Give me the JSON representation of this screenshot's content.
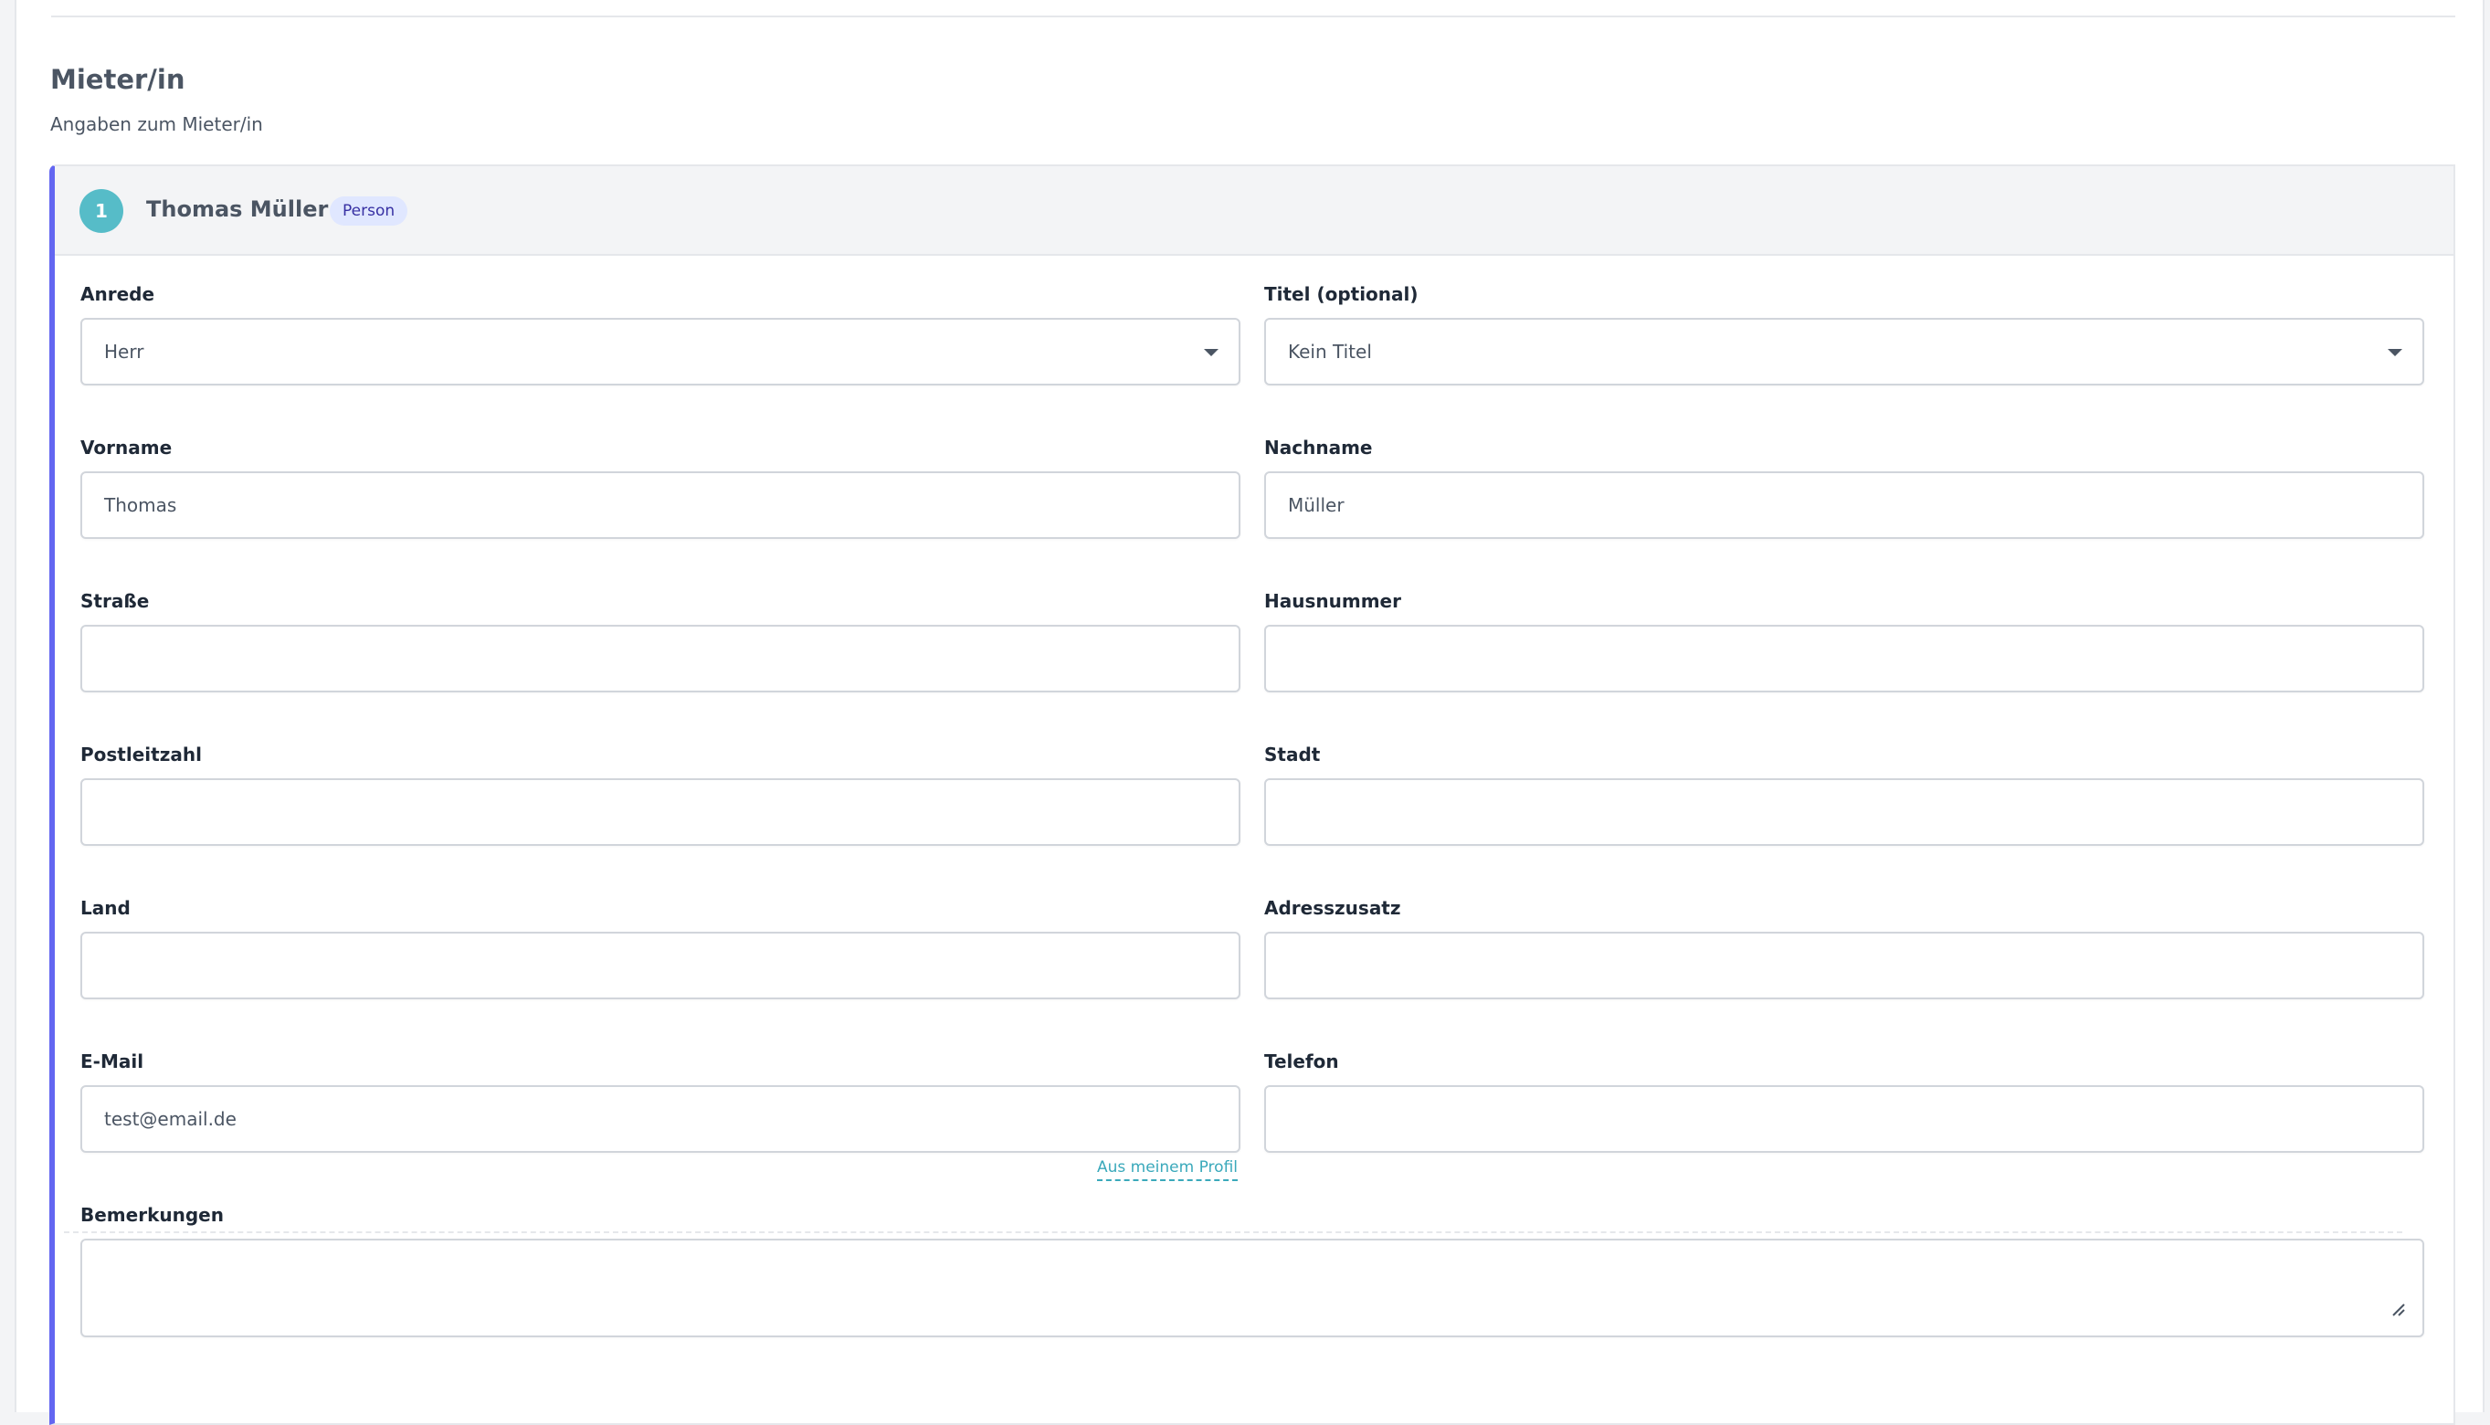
{
  "section": {
    "title": "Mieter/in",
    "subtitle": "Angaben zum Mieter/in"
  },
  "tenant": {
    "index": "1",
    "name": "Thomas Müller",
    "type_badge": "Person"
  },
  "form": {
    "anrede": {
      "label": "Anrede",
      "value": "Herr"
    },
    "titel": {
      "label": "Titel (optional)",
      "value": "Kein Titel"
    },
    "vorname": {
      "label": "Vorname",
      "value": "Thomas"
    },
    "nachname": {
      "label": "Nachname",
      "value": "Müller"
    },
    "strasse": {
      "label": "Straße",
      "value": ""
    },
    "hausnummer": {
      "label": "Hausnummer",
      "value": ""
    },
    "postleitzahl": {
      "label": "Postleitzahl",
      "value": ""
    },
    "stadt": {
      "label": "Stadt",
      "value": ""
    },
    "land": {
      "label": "Land",
      "value": ""
    },
    "adresszusatz": {
      "label": "Adresszusatz",
      "value": ""
    },
    "email": {
      "label": "E-Mail",
      "value": "test@email.de",
      "profile_link": "Aus meinem Profil"
    },
    "telefon": {
      "label": "Telefon",
      "value": ""
    },
    "bemerkungen": {
      "label": "Bemerkungen",
      "value": ""
    }
  },
  "colors": {
    "accent": "#6366f1",
    "step_circle": "#56bcc8",
    "link": "#3aa9bb",
    "badge_bg": "#e0e7ff"
  }
}
